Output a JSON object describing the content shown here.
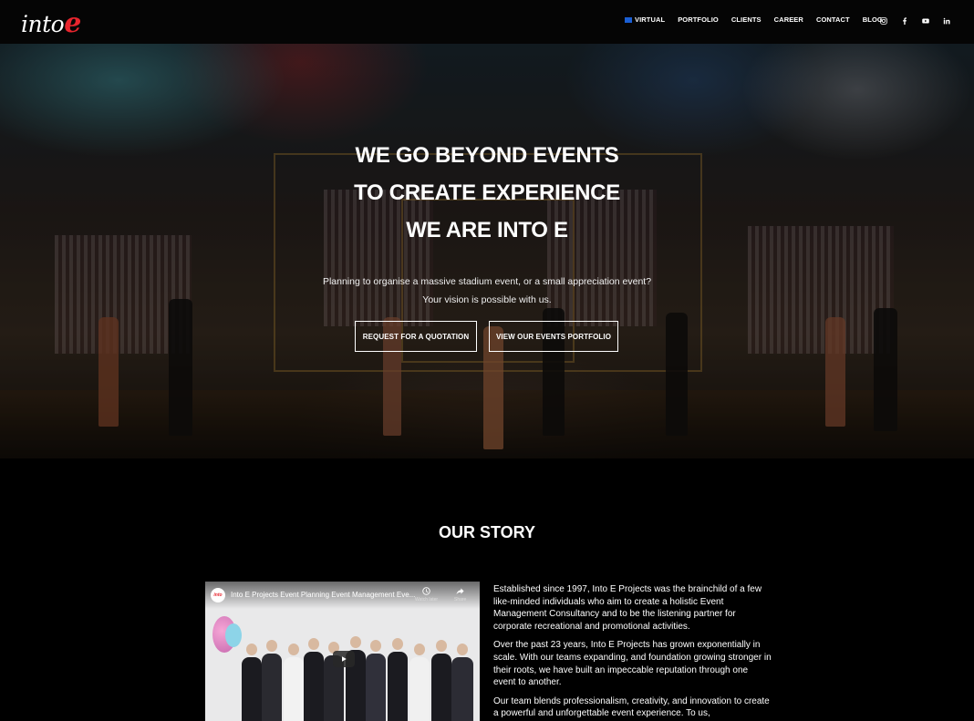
{
  "header": {
    "logo": {
      "text": "into",
      "accent": "e"
    },
    "nav": [
      {
        "label": "VIRTUAL",
        "has_flag": true
      },
      {
        "label": "PORTFOLIO"
      },
      {
        "label": "CLIENTS"
      },
      {
        "label": "CAREER"
      },
      {
        "label": "CONTACT"
      },
      {
        "label": "BLOG"
      }
    ],
    "social": [
      "instagram-icon",
      "facebook-icon",
      "youtube-icon",
      "linkedin-icon"
    ]
  },
  "hero": {
    "headline": [
      "WE GO BEYOND EVENTS",
      "TO CREATE EXPERIENCE",
      "WE ARE INTO E"
    ],
    "subtext": [
      "Planning to organise a massive stadium event, or a small appreciation event?",
      "Your vision is possible with us."
    ],
    "buttons": [
      "REQUEST FOR A QUOTATION",
      "VIEW OUR EVENTS PORTFOLIO"
    ]
  },
  "story": {
    "title": "OUR STORY",
    "video": {
      "title": "Into E Projects Event Planning Event Management Eve...",
      "channel_badge": "into",
      "watch_later": "Watch later",
      "share": "Share"
    },
    "paragraphs": [
      "Established since 1997, Into E Projects was the brainchild of a few like-minded individuals who aim to create a holistic Event Management Consultancy and to be the listening partner for corporate recreational and promotional activities.",
      "Over the past 23 years, Into E Projects has grown exponentially in scale. With our teams expanding, and foundation growing stronger in their roots, we have built an impeccable reputation through one event to another.",
      "Our team blends professionalism, creativity, and innovation to create a powerful and unforgettable event experience. To us,"
    ]
  },
  "colors": {
    "accent": "#e8252e",
    "background": "#000000"
  }
}
